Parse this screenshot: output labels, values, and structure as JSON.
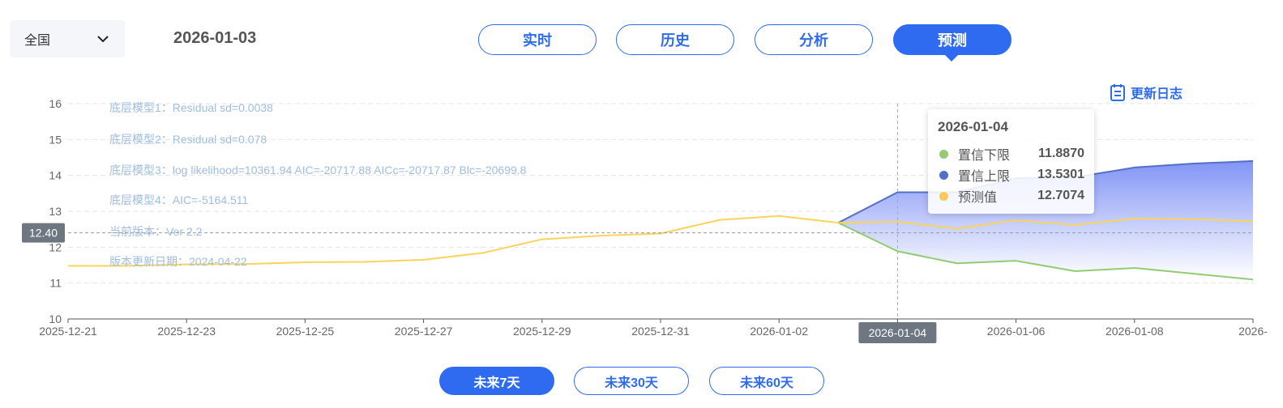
{
  "region_select": {
    "value": "全国"
  },
  "current_date": "2026-01-03",
  "tabs": [
    {
      "label": "实时",
      "active": false
    },
    {
      "label": "历史",
      "active": false
    },
    {
      "label": "分析",
      "active": false
    },
    {
      "label": "预测",
      "active": true
    }
  ],
  "changelog_label": "更新日志",
  "range_buttons": [
    {
      "label": "未来7天",
      "active": true
    },
    {
      "label": "未来30天",
      "active": false
    },
    {
      "label": "未来60天",
      "active": false
    }
  ],
  "model_info": [
    "底层模型1：Residual sd=0.0038",
    "底层模型2：Residual sd=0.078",
    "底层模型3：log likelihood=10361.94 AIC=-20717.88 AICc=-20717.87 Blc=-20699.8",
    "底层模型4：AIC=-5164.511",
    "当前版本：Ver 2.2",
    "版本更新日期：2024-04-22"
  ],
  "crosshair": {
    "y_label": "12.40",
    "x_label": "2026-01-04"
  },
  "tooltip": {
    "date": "2026-01-04",
    "rows": [
      {
        "name": "置信下限",
        "value": "11.8870",
        "color": "#91cc75"
      },
      {
        "name": "置信上限",
        "value": "13.5301",
        "color": "#5470c6"
      },
      {
        "name": "预测值",
        "value": "12.7074",
        "color": "#fac858"
      }
    ]
  },
  "colors": {
    "accent": "#2f6bf0",
    "forecast_line": "#fad35a",
    "lower_line": "#91cc75",
    "upper_line": "#5470c6",
    "band_top": "#7b8ef5"
  },
  "chart_data": {
    "type": "line",
    "x": [
      "2025-12-21",
      "2025-12-22",
      "2025-12-23",
      "2025-12-24",
      "2025-12-25",
      "2025-12-26",
      "2025-12-27",
      "2025-12-28",
      "2025-12-29",
      "2025-12-30",
      "2025-12-31",
      "2026-01-01",
      "2026-01-02",
      "2026-01-03",
      "2026-01-04",
      "2026-01-05",
      "2026-01-06",
      "2026-01-07",
      "2026-01-08",
      "2026-01-09",
      "2026-01-10"
    ],
    "x_tick_labels": [
      "2025-12-21",
      "2025-12-23",
      "2025-12-25",
      "2025-12-27",
      "2025-12-29",
      "2025-12-31",
      "2026-01-02",
      "2026-01-04",
      "2026-01-06",
      "2026-01-08",
      "2026-"
    ],
    "ylim": [
      10,
      16
    ],
    "yticks": [
      10,
      11,
      12,
      13,
      14,
      15,
      16
    ],
    "grid": true,
    "series": [
      {
        "name": "预测值",
        "values": [
          11.48,
          11.48,
          11.52,
          11.53,
          11.58,
          11.59,
          11.65,
          11.84,
          12.22,
          12.32,
          12.38,
          12.76,
          12.87,
          12.68,
          12.7074,
          12.52,
          12.75,
          12.62,
          12.8,
          12.78,
          12.72
        ]
      },
      {
        "name": "置信上限",
        "values": [
          null,
          null,
          null,
          null,
          null,
          null,
          null,
          null,
          null,
          null,
          null,
          null,
          null,
          12.68,
          13.5301,
          13.53,
          13.92,
          13.95,
          14.22,
          14.33,
          14.4
        ]
      },
      {
        "name": "置信下限",
        "values": [
          null,
          null,
          null,
          null,
          null,
          null,
          null,
          null,
          null,
          null,
          null,
          null,
          null,
          12.68,
          11.887,
          11.55,
          11.62,
          11.33,
          11.42,
          11.26,
          11.1
        ]
      }
    ]
  }
}
